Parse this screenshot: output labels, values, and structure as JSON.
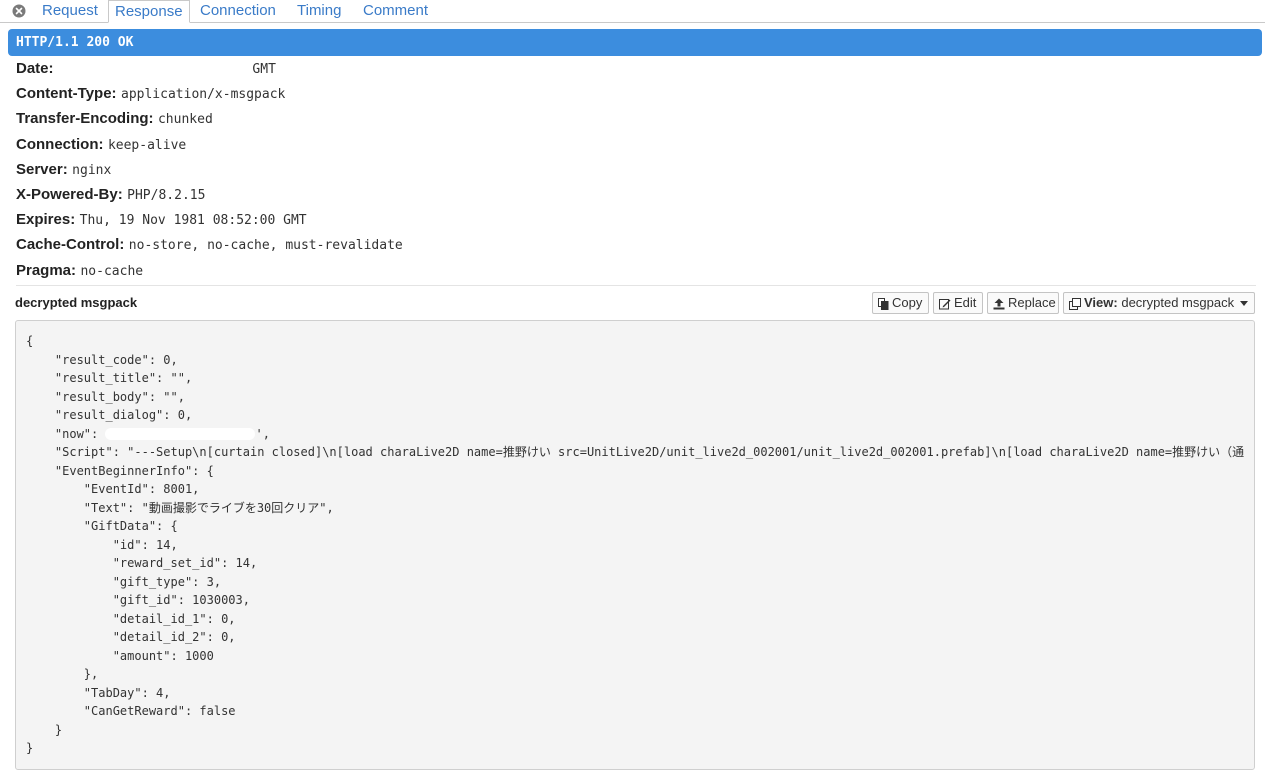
{
  "tabs": [
    {
      "label": "Request",
      "active": false
    },
    {
      "label": "Response",
      "active": true
    },
    {
      "label": "Connection",
      "active": false
    },
    {
      "label": "Timing",
      "active": false
    },
    {
      "label": "Comment",
      "active": false
    }
  ],
  "status_line": "HTTP/1.1 200 OK",
  "headers": [
    {
      "name": "Date",
      "value": "GMT"
    },
    {
      "name": "Content-Type",
      "value": "application/x-msgpack"
    },
    {
      "name": "Transfer-Encoding",
      "value": "chunked"
    },
    {
      "name": "Connection",
      "value": "keep-alive"
    },
    {
      "name": "Server",
      "value": "nginx"
    },
    {
      "name": "X-Powered-By",
      "value": "PHP/8.2.15"
    },
    {
      "name": "Expires",
      "value": "Thu, 19 Nov 1981 08:52:00 GMT"
    },
    {
      "name": "Cache-Control",
      "value": "no-store, no-cache, must-revalidate"
    },
    {
      "name": "Pragma",
      "value": "no-cache"
    }
  ],
  "body": {
    "title": "decrypted msgpack",
    "copy_label": "Copy",
    "edit_label": "Edit",
    "replace_label": "Replace",
    "view_prefix": "View:",
    "view_value": "decrypted msgpack"
  },
  "code_lines": [
    "{",
    "    \"result_code\": 0,",
    "    \"result_title\": \"\",",
    "    \"result_body\": \"\",",
    "    \"result_dialog\": 0,",
    "    \"now\": ",
    "    \"Script\": \"---Setup\\n[curtain closed]\\n[load charaLive2D name=推野けい src=UnitLive2D/unit_live2d_002001/unit_live2d_002001.prefab]\\n[load charaLive2D name=推野けい（通",
    "    \"EventBeginnerInfo\": {",
    "        \"EventId\": 8001,",
    "        \"Text\": \"動画撮影でライブを30回クリア\",",
    "        \"GiftData\": {",
    "            \"id\": 14,",
    "            \"reward_set_id\": 14,",
    "            \"gift_type\": 3,",
    "            \"gift_id\": 1030003,",
    "            \"detail_id_1\": 0,",
    "            \"detail_id_2\": 0,",
    "            \"amount\": 1000",
    "        },",
    "        \"TabDay\": 4,",
    "        \"CanGetReward\": false",
    "    }",
    "}"
  ],
  "now_suffix": "',"
}
